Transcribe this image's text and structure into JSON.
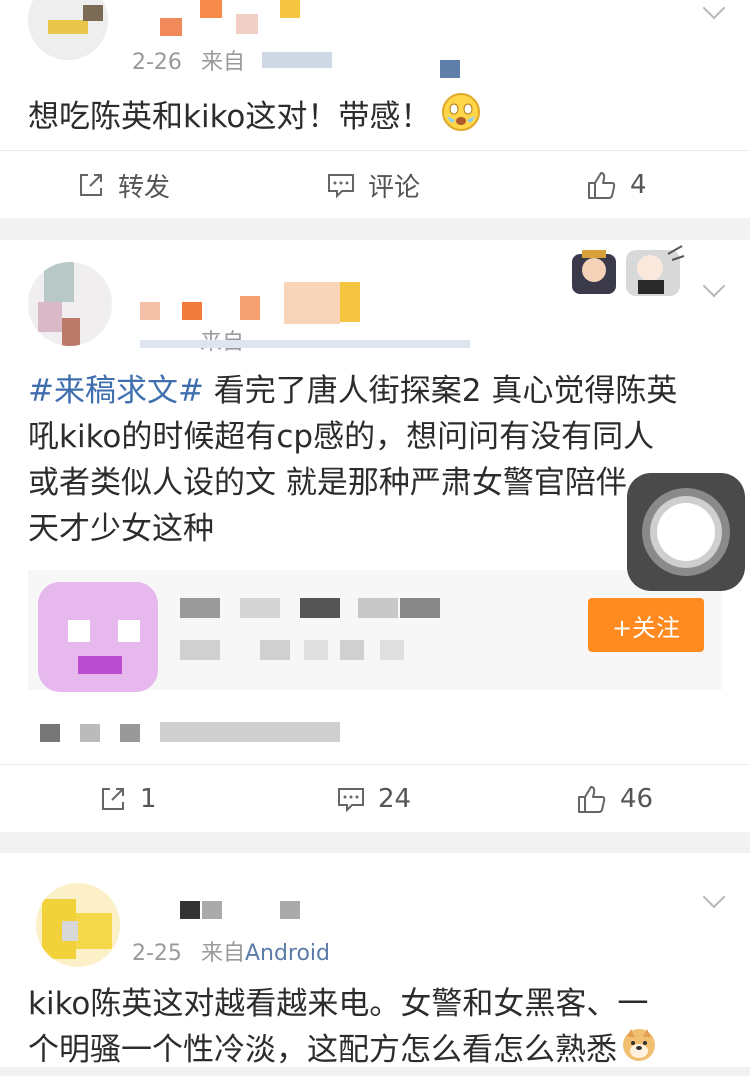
{
  "comments": [
    {
      "date": "2-26",
      "source_prefix": "来自",
      "text": "想吃陈英和kiko这对！带感！",
      "emoji_icon": "scared-face-emoji-icon",
      "actions": {
        "repost_label": "转发",
        "comment_label": "评论",
        "like_count": "4"
      }
    },
    {
      "source_prefix": "来自",
      "hashtag": "#来稿求文#",
      "text_lines": [
        " 看完了唐人街探案2 真心觉得陈英",
        "吼kiko的时候超有cp感的，想问问有没有同人",
        "或者类似人设的文 就是那种严肃女警官陪伴",
        "天才少女这种"
      ],
      "follow_label": "+关注",
      "actions": {
        "repost_count": "1",
        "comment_count": "24",
        "like_count": "46"
      }
    },
    {
      "date": "2-25",
      "source_prefix": "来自",
      "source_name": "Android",
      "text_lines": [
        "kiko陈英这对越看越来电。女警和女黑客、一",
        "个明骚一个性冷淡，这配方怎么看怎么熟悉"
      ],
      "emoji_icon": "doge-emoji-icon"
    }
  ],
  "colors": {
    "accent_link": "#3f6fae",
    "follow_button": "#ff8a1f",
    "background": "#f2f2f2"
  }
}
